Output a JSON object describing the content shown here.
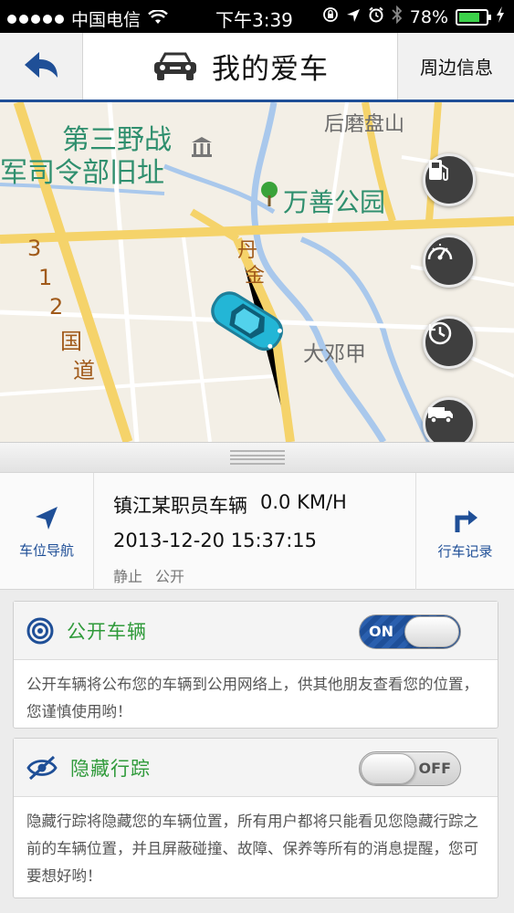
{
  "status_bar": {
    "carrier": "中国电信",
    "time": "下午3:39",
    "battery_percent": "78%",
    "battery_level": 0.78
  },
  "nav": {
    "title": "我的爱车",
    "right_label": "周边信息"
  },
  "map": {
    "labels": {
      "poi_1_line1": "第三野战",
      "poi_1_line2": "军司令部旧址",
      "park": "万善公园",
      "area_top": "后磨盘山",
      "village": "大邓甲",
      "road_danjin_1": "丹",
      "road_danjin_2": "金",
      "road_312_a": "3",
      "road_312_b": "1",
      "road_312_c": "2",
      "road_312_d": "国",
      "road_312_e": "道"
    },
    "icons": [
      "fuel-icon",
      "speedometer-icon",
      "history-clock-icon",
      "truck-icon"
    ],
    "colors": {
      "major_road": "#f5d36a",
      "minor_road": "#ffffff",
      "water": "#a9c8ec",
      "land": "#f3efe6"
    }
  },
  "info": {
    "nav_button": "车位导航",
    "record_button": "行车记录",
    "vehicle_name": "镇江某职员车辆",
    "speed": "0.0 KM/H",
    "datetime": "2013-12-20 15:37:15",
    "state": "静止",
    "visibility": "公开"
  },
  "public_card": {
    "title": "公开车辆",
    "toggle_label": "ON",
    "toggle_state": true,
    "description": "公开车辆将公布您的车辆到公用网络上，供其他朋友查看您的位置，您谨慎使用哟！"
  },
  "hide_card": {
    "title": "隐藏行踪",
    "toggle_label": "OFF",
    "toggle_state": false,
    "description": "隐藏行踪将隐藏您的车辆位置，所有用户都将只能看见您隐藏行踪之前的车辆位置，并且屏蔽碰撞、故障、保养等所有的消息提醒，您可要想好哟！"
  },
  "theme": {
    "accent_blue": "#1f4f97",
    "accent_green": "#2f9a3a",
    "car_color": "#23b6d6"
  }
}
